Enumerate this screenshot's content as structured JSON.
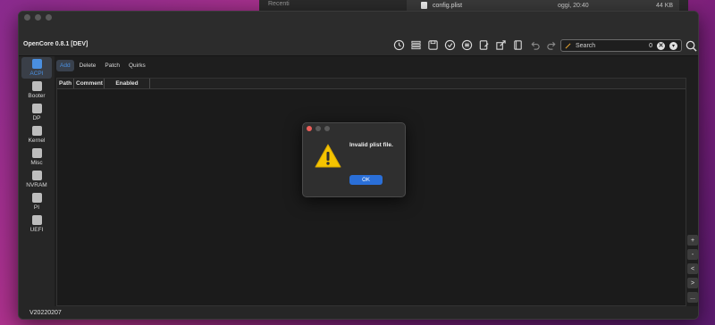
{
  "finder": {
    "recent_label": "Recenti",
    "file_name": "config.plist",
    "file_date": "oggi, 20:40",
    "file_size": "44 KB"
  },
  "app": {
    "title": "OpenCore 0.8.1 [DEV]",
    "version": "V20220207"
  },
  "toolbar": {
    "icons": [
      "clock-icon",
      "list-icon",
      "save-icon",
      "check-icon",
      "compare-icon",
      "edit-doc-icon",
      "share-icon",
      "book-icon",
      "undo-icon",
      "redo-icon"
    ]
  },
  "search": {
    "placeholder": "Search",
    "count": "0",
    "clear_glyph": "✕",
    "dropdown_glyph": "▾"
  },
  "sidebar": {
    "items": [
      {
        "label": "ACPI",
        "icon": "acpi-icon",
        "active": true
      },
      {
        "label": "Booter",
        "icon": "rocket-icon",
        "active": false
      },
      {
        "label": "DP",
        "icon": "display-icon",
        "active": false
      },
      {
        "label": "Kernel",
        "icon": "kernel-icon",
        "active": false
      },
      {
        "label": "Misc",
        "icon": "misc-icon",
        "active": false
      },
      {
        "label": "NVRAM",
        "icon": "chip-icon",
        "active": false
      },
      {
        "label": "PI",
        "icon": "monitor-icon",
        "active": false
      },
      {
        "label": "UEFI",
        "icon": "cube-icon",
        "active": false
      }
    ]
  },
  "tabs": [
    {
      "label": "Add",
      "active": true
    },
    {
      "label": "Delete",
      "active": false
    },
    {
      "label": "Patch",
      "active": false
    },
    {
      "label": "Quirks",
      "active": false
    }
  ],
  "table": {
    "columns": [
      "Path",
      "Comment",
      "Enabled"
    ]
  },
  "side_buttons": [
    "+",
    "-",
    "<",
    ">",
    "..."
  ],
  "dialog": {
    "message": "Invalid plist file.",
    "ok_label": "OK"
  },
  "colors": {
    "accent": "#4a8fe0",
    "ok_button": "#2a6fd8",
    "warning": "#f5c400"
  }
}
